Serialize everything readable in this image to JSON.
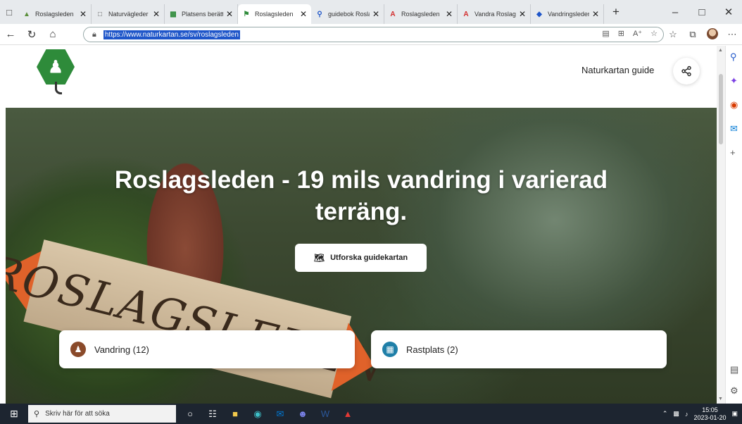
{
  "browser": {
    "tabs": [
      {
        "label": "Roslagsleden",
        "icon": "forest-icon",
        "color": "#5a8f3a",
        "active": false
      },
      {
        "label": "Naturvägleder",
        "icon": "page-icon",
        "color": "#666666",
        "active": false
      },
      {
        "label": "Platsens berättelse",
        "icon": "hiker-icon",
        "color": "#2e8b3a",
        "active": false
      },
      {
        "label": "Roslagsleden",
        "icon": "trail-icon",
        "color": "#2e8b3a",
        "active": true
      },
      {
        "label": "guidebok Roslagsleden",
        "icon": "search-icon",
        "color": "#1f56c9",
        "active": false
      },
      {
        "label": "Roslagsleden",
        "icon": "pdf-icon",
        "color": "#d32f2f",
        "active": false
      },
      {
        "label": "Vandra Roslagsleden",
        "icon": "pdf-icon",
        "color": "#d32f2f",
        "active": false
      },
      {
        "label": "Vandringsleder",
        "icon": "shield-icon",
        "color": "#1f56c9",
        "active": false
      }
    ],
    "url": "https://www.naturkartan.se/sv/roslagsleden"
  },
  "site": {
    "guide_link": "Naturkartan guide",
    "hero_title": "Roslagsleden - 19 mils vandring i varierad terräng.",
    "sign_text": "ROSLAGSLEDEN",
    "explore_button": "Utforska guidekartan",
    "cards": [
      {
        "label": "Vandring (12)",
        "icon": "hiking-icon",
        "color": "#8a4a2a"
      },
      {
        "label": "Rastplats (2)",
        "icon": "picnic-table-icon",
        "color": "#1f7fa8"
      }
    ]
  },
  "taskbar": {
    "search_placeholder": "Skriv här för att söka",
    "time": "15:05",
    "date": "2023-01-20"
  }
}
